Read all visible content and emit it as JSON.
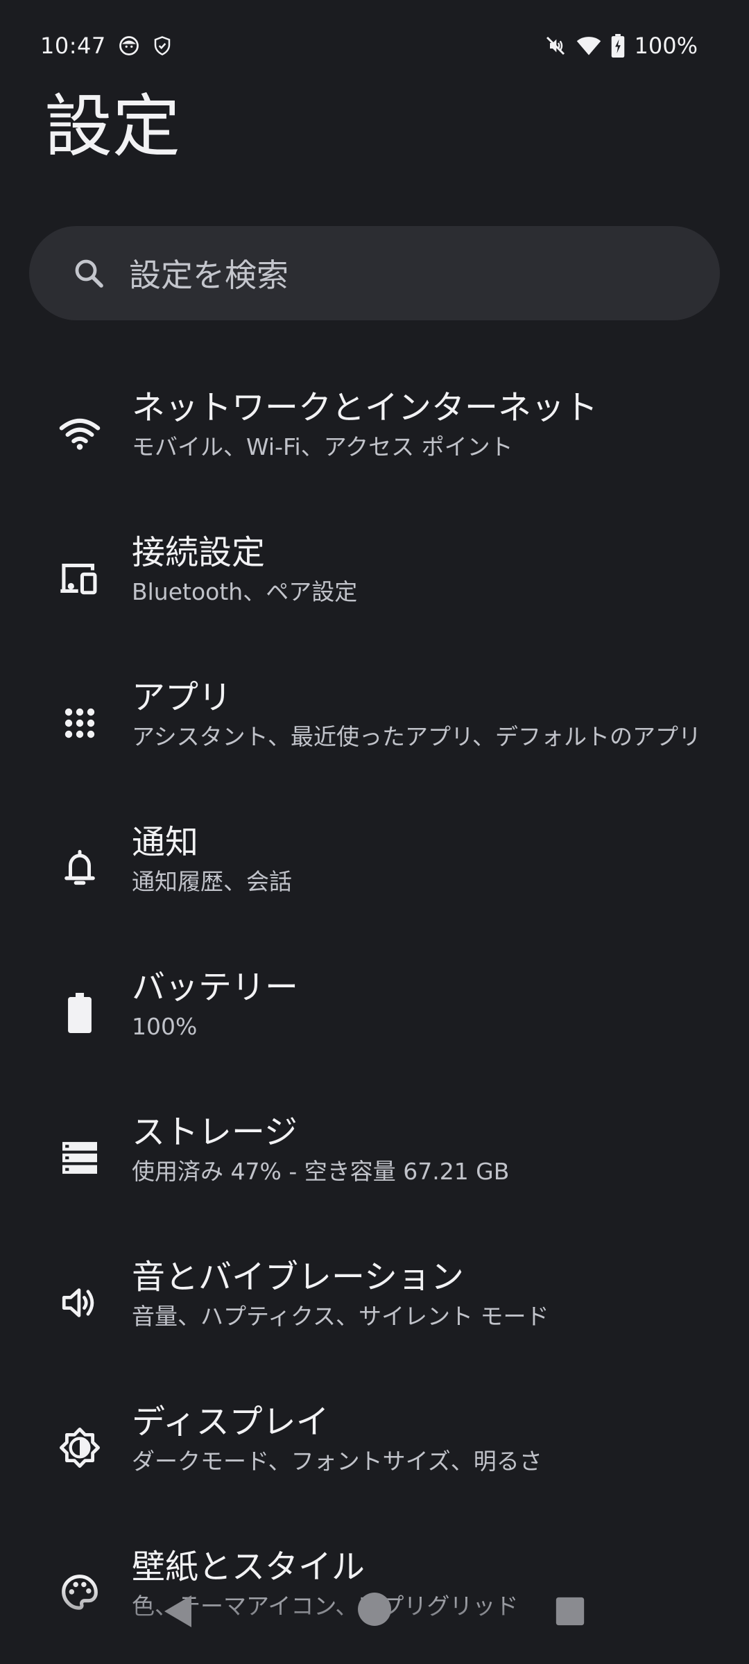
{
  "status_bar": {
    "time": "10:47",
    "battery_percent": "100%",
    "icons": [
      "face-icon",
      "shield-icon",
      "mute-icon",
      "wifi-icon",
      "battery-charging-icon"
    ]
  },
  "page": {
    "title": "設定"
  },
  "search": {
    "placeholder": "設定を検索",
    "icon": "search-icon"
  },
  "settings": [
    {
      "icon": "wifi-icon",
      "title": "ネットワークとインターネット",
      "subtitle": "モバイル、Wi-Fi、アクセス ポイント"
    },
    {
      "icon": "devices-icon",
      "title": "接続設定",
      "subtitle": "Bluetooth、ペア設定"
    },
    {
      "icon": "apps-grid-icon",
      "title": "アプリ",
      "subtitle": "アシスタント、最近使ったアプリ、デフォルトのアプリ"
    },
    {
      "icon": "bell-icon",
      "title": "通知",
      "subtitle": "通知履歴、会話"
    },
    {
      "icon": "battery-icon",
      "title": "バッテリー",
      "subtitle": "100%"
    },
    {
      "icon": "storage-icon",
      "title": "ストレージ",
      "subtitle": "使用済み 47% - 空き容量 67.21 GB"
    },
    {
      "icon": "volume-icon",
      "title": "音とバイブレーション",
      "subtitle": "音量、ハプティクス、サイレント モード"
    },
    {
      "icon": "brightness-icon",
      "title": "ディスプレイ",
      "subtitle": "ダークモード、フォントサイズ、明るさ"
    },
    {
      "icon": "palette-icon",
      "title": "壁紙とスタイル",
      "subtitle": "色、テーマアイコン、アプリグリッド"
    }
  ],
  "colors": {
    "background": "#1b1c20",
    "search_bg": "#2c2d32",
    "text_primary": "#f2f2f4",
    "text_secondary": "#c1c3ca"
  }
}
